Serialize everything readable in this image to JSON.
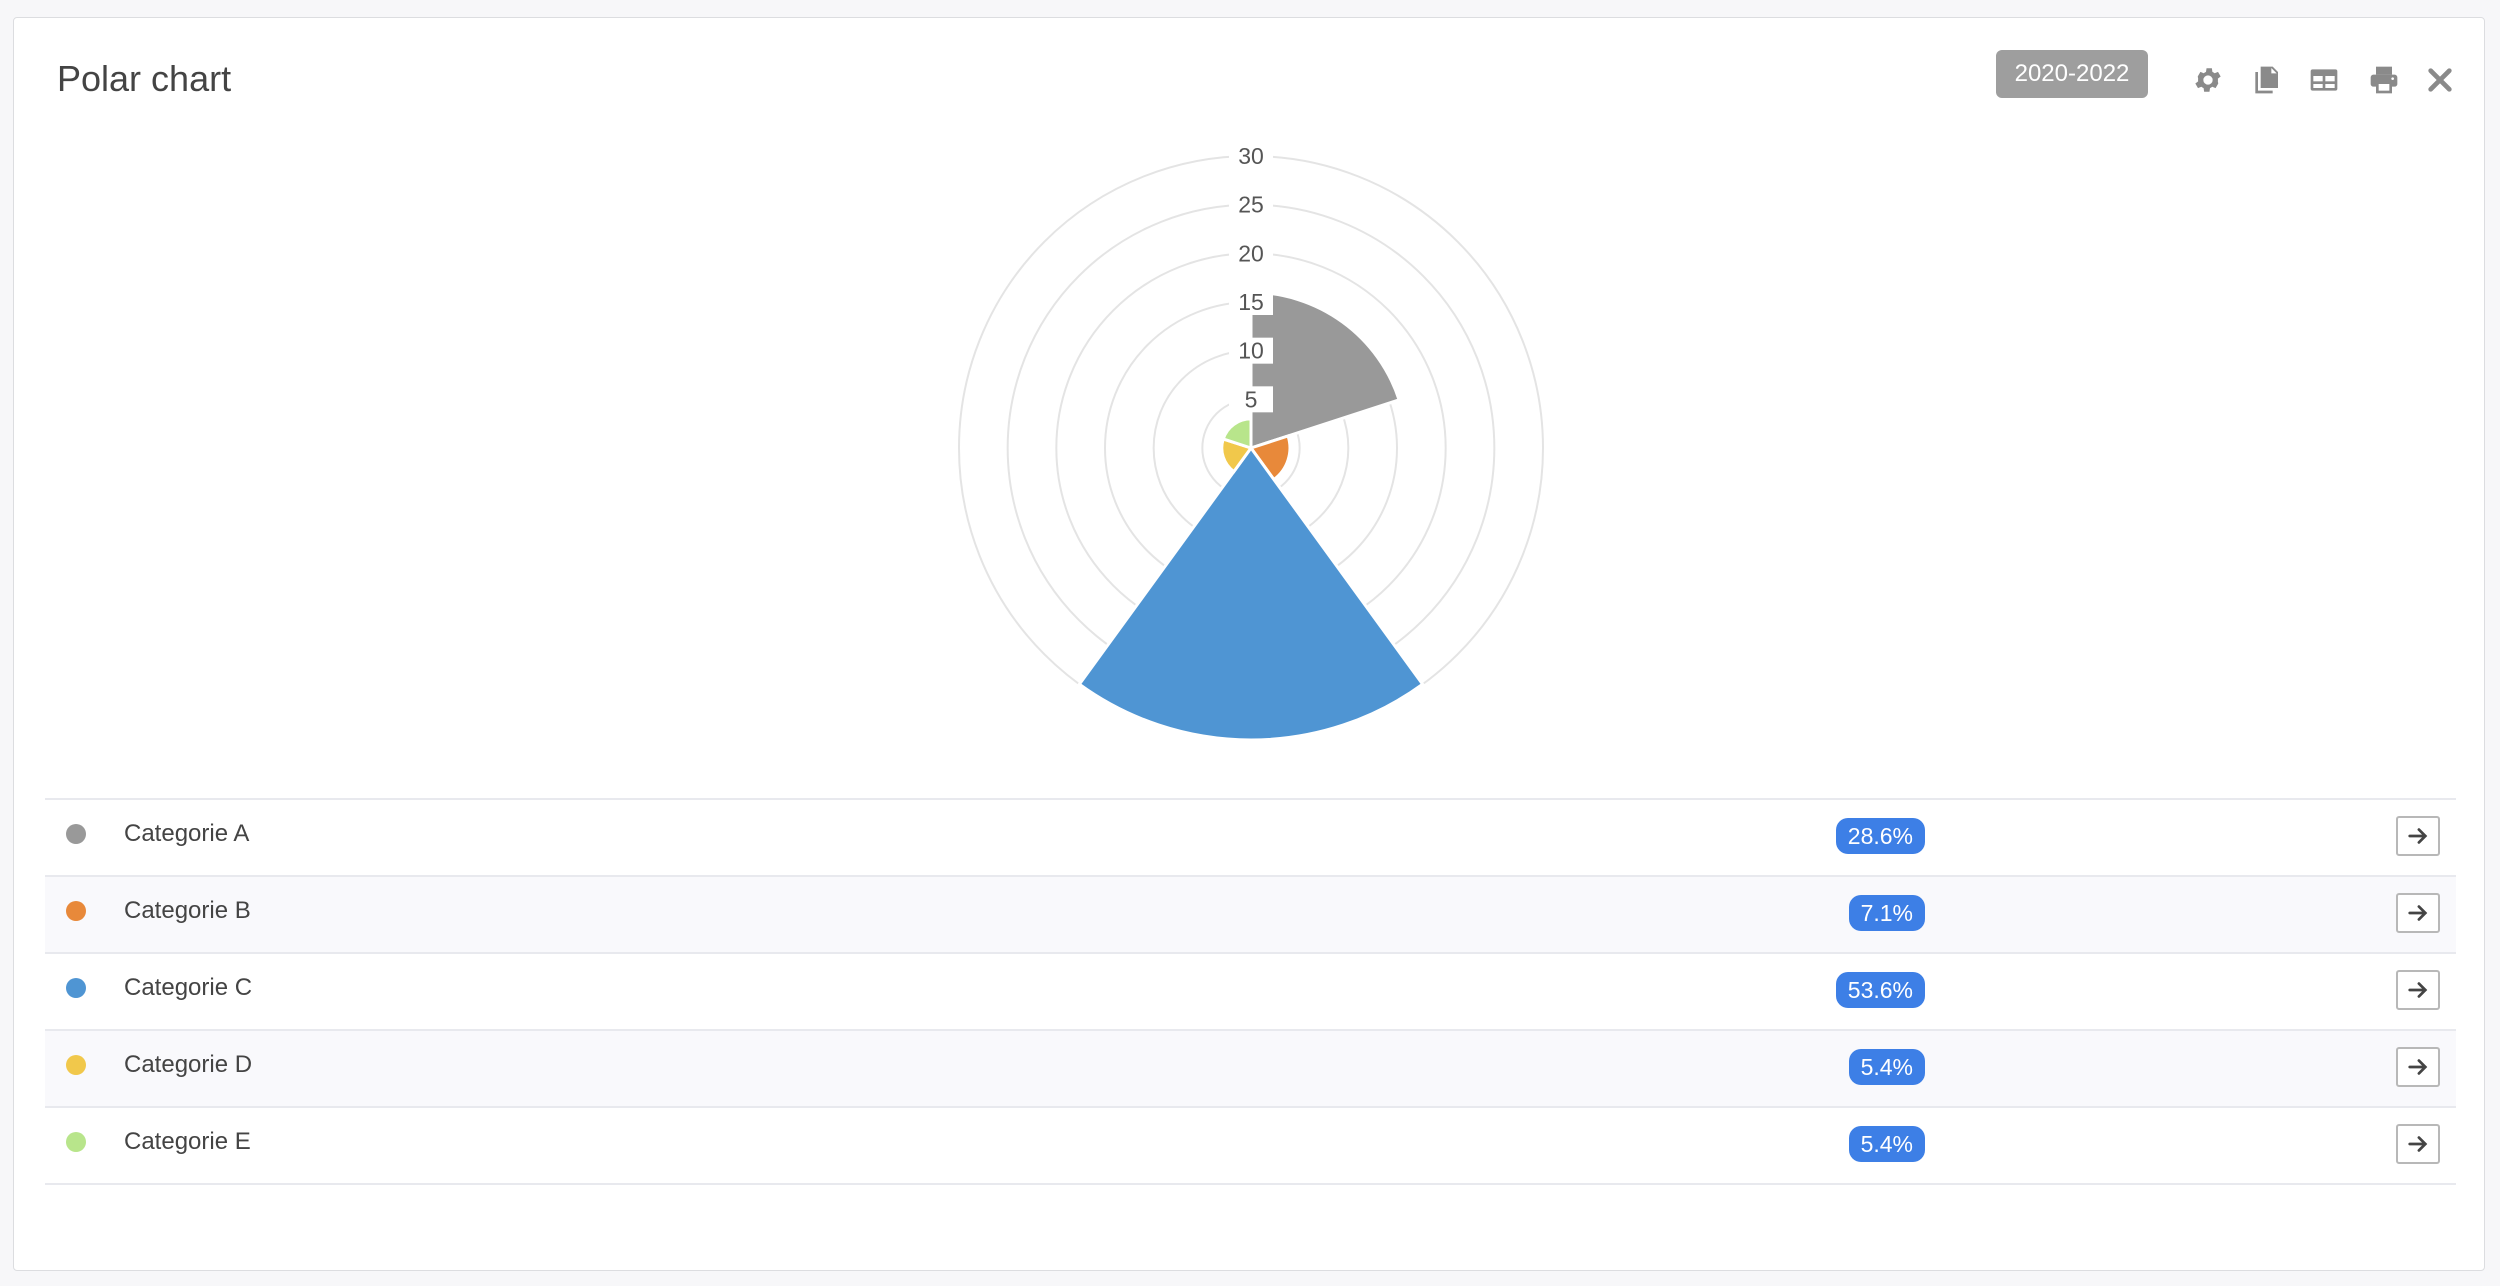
{
  "header": {
    "title": "Polar chart",
    "range_label": "2020-2022"
  },
  "toolbar": {
    "icons": [
      "gear-icon",
      "copy-icon",
      "table-icon",
      "print-icon",
      "close-icon"
    ]
  },
  "colors": {
    "accent": "#3d7fe6",
    "A": "#999999",
    "B": "#e8893a",
    "C": "#4f95d3",
    "D": "#f1c84b",
    "E": "#b8e58b"
  },
  "chart_data": {
    "type": "polarArea",
    "categories": [
      "Categorie A",
      "Categorie B",
      "Categorie C",
      "Categorie D",
      "Categorie E"
    ],
    "values": [
      16,
      4,
      30,
      3,
      3
    ],
    "r_ticks": [
      5,
      10,
      15,
      20,
      25,
      30
    ],
    "rlim": [
      0,
      30
    ],
    "grid": true
  },
  "legend": {
    "rows": [
      {
        "label": "Categorie A",
        "pct": "28.6%",
        "color": "#999999"
      },
      {
        "label": "Categorie B",
        "pct": "7.1%",
        "color": "#e8893a"
      },
      {
        "label": "Categorie C",
        "pct": "53.6%",
        "color": "#4f95d3"
      },
      {
        "label": "Categorie D",
        "pct": "5.4%",
        "color": "#f1c84b"
      },
      {
        "label": "Categorie E",
        "pct": "5.4%",
        "color": "#b8e58b"
      }
    ]
  }
}
